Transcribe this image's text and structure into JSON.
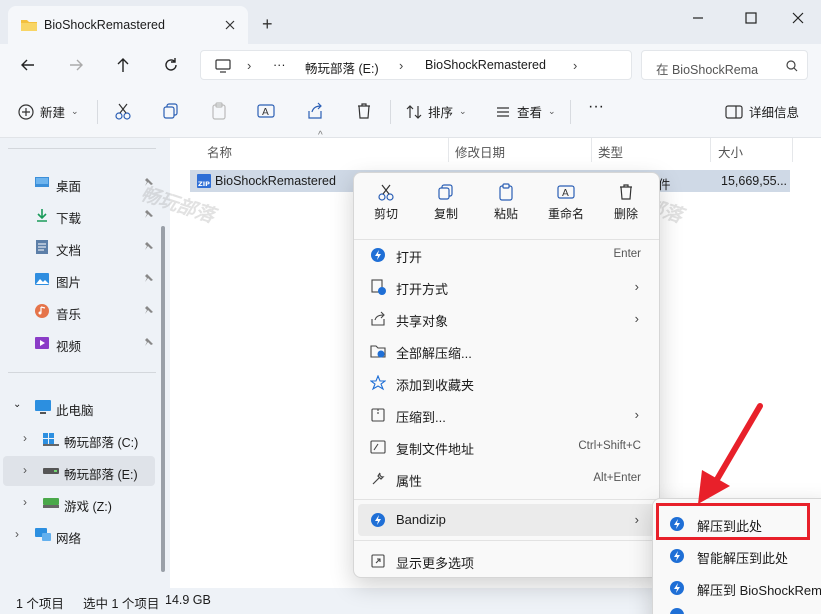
{
  "window": {
    "tab_title": "BioShockRemastered",
    "new_tab": "+"
  },
  "address": {
    "ellipsis": "···",
    "crumbs": [
      "畅玩部落 (E:)",
      "BioShockRemastered"
    ],
    "search_placeholder": "在 BioShockRema"
  },
  "toolbar": {
    "new_label": "新建",
    "sort_label": "排序",
    "view_label": "查看",
    "more": "···",
    "details_label": "详细信息"
  },
  "sidebar": {
    "quick": [
      {
        "label": "桌面",
        "icon": "desktop-icon"
      },
      {
        "label": "下载",
        "icon": "download-icon"
      },
      {
        "label": "文档",
        "icon": "document-icon"
      },
      {
        "label": "图片",
        "icon": "pictures-icon"
      },
      {
        "label": "音乐",
        "icon": "music-icon"
      },
      {
        "label": "视频",
        "icon": "video-icon"
      }
    ],
    "this_pc": "此电脑",
    "drives": [
      "畅玩部落 (C:)",
      "畅玩部落 (E:)",
      "游戏 (Z:)"
    ],
    "network": "网络"
  },
  "columns": {
    "name": "名称",
    "modified": "修改日期",
    "type": "类型",
    "size": "大小"
  },
  "file": {
    "name": "BioShockRemastered",
    "type_partial": "件",
    "size": "15,669,55..."
  },
  "context_menu": {
    "quick_actions": [
      "剪切",
      "复制",
      "粘贴",
      "重命名",
      "删除"
    ],
    "items": [
      {
        "label": "打开",
        "shortcut": "Enter",
        "submenu": false
      },
      {
        "label": "打开方式",
        "shortcut": "",
        "submenu": true
      },
      {
        "label": "共享对象",
        "shortcut": "",
        "submenu": true
      },
      {
        "label": "全部解压缩...",
        "shortcut": "",
        "submenu": false
      },
      {
        "label": "添加到收藏夹",
        "shortcut": "",
        "submenu": false
      },
      {
        "label": "压缩到...",
        "shortcut": "",
        "submenu": true
      },
      {
        "label": "复制文件地址",
        "shortcut": "Ctrl+Shift+C",
        "submenu": false
      },
      {
        "label": "属性",
        "shortcut": "Alt+Enter",
        "submenu": false
      }
    ],
    "bandizip": "Bandizip",
    "more_options": "显示更多选项"
  },
  "submenu": {
    "items": [
      "解压到此处",
      "智能解压到此处",
      "解压到 BioShockRem"
    ]
  },
  "status": {
    "count": "1 个项目",
    "selected": "选中 1 个项目",
    "size": "14.9 GB"
  },
  "watermark": "畅玩部落",
  "colors": {
    "accent": "#0067c0",
    "highlight_box": "#e8202a",
    "arrow": "#e8202a",
    "bandizip_blue": "#1f6fd6"
  }
}
